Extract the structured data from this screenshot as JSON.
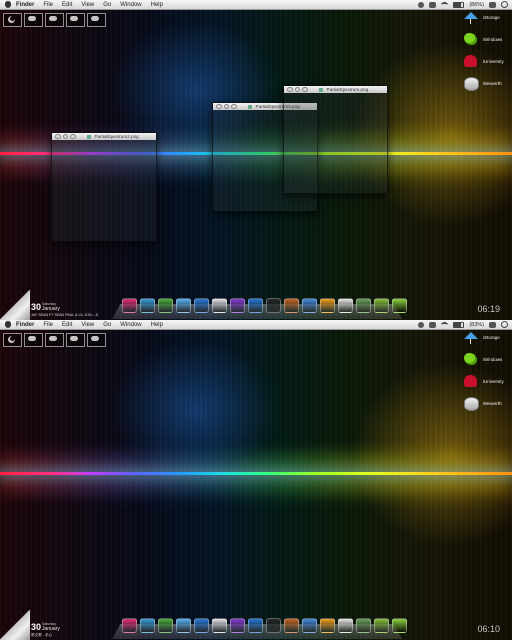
{
  "screens": [
    {
      "menubar": {
        "app": "Finder",
        "items": [
          "File",
          "Edit",
          "View",
          "Go",
          "Window",
          "Help"
        ],
        "status": "(86%)"
      },
      "weather": [
        {
          "icon": "moon-icon",
          "label": ""
        },
        {
          "icon": "cloud-icon",
          "label": ""
        },
        {
          "icon": "cloud-icon",
          "label": ""
        },
        {
          "icon": "cloud-icon",
          "label": ""
        },
        {
          "icon": "cloud-icon",
          "label": ""
        }
      ],
      "drives": [
        {
          "name": "iStorage",
          "icon": "umbrella-drive-icon"
        },
        {
          "name": "iWindows",
          "icon": "green-drive-icon"
        },
        {
          "name": "iUniversity",
          "icon": "red-chair-drive-icon"
        },
        {
          "name": "iWewerth",
          "icon": "silver-drive-icon"
        }
      ],
      "windows": [
        {
          "title": "PartialSpectrum2.png"
        },
        {
          "title": "PartialSpectrum3.png"
        },
        {
          "title": "PartialSpectrum.png"
        }
      ],
      "date": {
        "day": "30",
        "weekday": "Saturday",
        "month": "January",
        "line": "JAY SEAN FT SEAN PAUL & LIL JON – D"
      },
      "clock": "06:19"
    },
    {
      "menubar": {
        "app": "Finder",
        "items": [
          "File",
          "Edit",
          "View",
          "Go",
          "Window",
          "Help"
        ],
        "status": "(83%)"
      },
      "weather": [
        {
          "icon": "moon-icon",
          "label": ""
        },
        {
          "icon": "cloud-icon",
          "label": ""
        },
        {
          "icon": "cloud-icon",
          "label": ""
        },
        {
          "icon": "cloud-icon",
          "label": ""
        },
        {
          "icon": "cloud-icon",
          "label": ""
        }
      ],
      "drives": [
        {
          "name": "iStorage",
          "icon": "umbrella-drive-icon"
        },
        {
          "name": "iWindows",
          "icon": "green-drive-icon"
        },
        {
          "name": "iUniversity",
          "icon": "red-chair-drive-icon"
        },
        {
          "name": "iWewerth",
          "icon": "silver-drive-icon"
        }
      ],
      "windows": [],
      "date": {
        "day": "30",
        "weekday": "Saturday",
        "month": "January",
        "line": "蔡文蕾 - 手心"
      },
      "clock": "06:10"
    }
  ],
  "dock_icons": [
    {
      "name": "pink-app-icon",
      "color": "#e0357a"
    },
    {
      "name": "globe-app-icon",
      "color": "#3aa0d8"
    },
    {
      "name": "teapot-app-icon",
      "color": "#4cae3c"
    },
    {
      "name": "safari-app-icon",
      "color": "#5ab4f0"
    },
    {
      "name": "blue-ball-app-icon",
      "color": "#2e7fd6"
    },
    {
      "name": "white-robot-app-icon",
      "color": "#e8e8e8"
    },
    {
      "name": "purple-book-app-icon",
      "color": "#8a3fd0"
    },
    {
      "name": "word-app-icon",
      "color": "#2a7ad6"
    },
    {
      "name": "terminal-app-icon",
      "color": "#2a2a2a"
    },
    {
      "name": "owl-app-icon",
      "color": "#c86a2a"
    },
    {
      "name": "itunes-app-icon",
      "color": "#4a8ae0"
    },
    {
      "name": "vlc-app-icon",
      "color": "#f0a020"
    },
    {
      "name": "preview-app-icon",
      "color": "#e8e8e8"
    },
    {
      "name": "photo-app-icon",
      "color": "#6aa060"
    },
    {
      "name": "download-app-icon",
      "color": "#8ac040"
    },
    {
      "name": "trash-app-icon",
      "color": "#8ad040"
    }
  ]
}
